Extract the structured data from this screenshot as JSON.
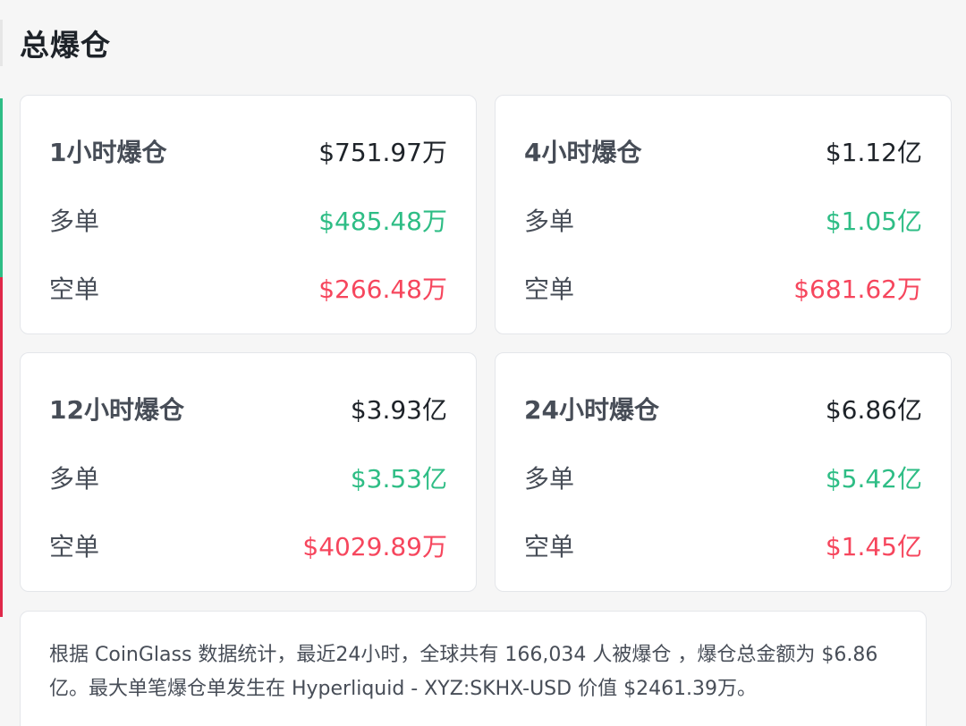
{
  "title": "总爆仓",
  "cards": [
    {
      "label": "1小时爆仓",
      "total": "$751.97万",
      "long_label": "多单",
      "long_value": "$485.48万",
      "short_label": "空单",
      "short_value": "$266.48万"
    },
    {
      "label": "4小时爆仓",
      "total": "$1.12亿",
      "long_label": "多单",
      "long_value": "$1.05亿",
      "short_label": "空单",
      "short_value": "$681.62万"
    },
    {
      "label": "12小时爆仓",
      "total": "$3.93亿",
      "long_label": "多单",
      "long_value": "$3.53亿",
      "short_label": "空单",
      "short_value": "$4029.89万"
    },
    {
      "label": "24小时爆仓",
      "total": "$6.86亿",
      "long_label": "多单",
      "long_value": "$5.42亿",
      "short_label": "空单",
      "short_value": "$1.45亿"
    }
  ],
  "summary": "根据 CoinGlass 数据统计，最近24小时，全球共有 166,034 人被爆仓 ，爆仓总金额为 $6.86 亿。最大单笔爆仓单发生在 Hyperliquid - XYZ:SKHX-USD 价值 $2461.39万。",
  "colors": {
    "long": "#2ebd85",
    "short": "#f6465d",
    "text": "#1e2329",
    "card_bg": "#ffffff",
    "page_bg": "#f6f6f6"
  }
}
